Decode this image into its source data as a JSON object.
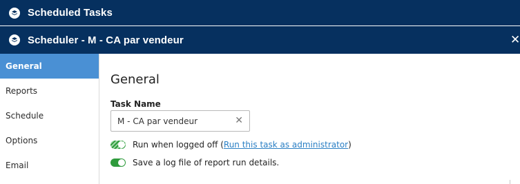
{
  "window": {
    "outer_title": "Scheduled Tasks",
    "inner_title": "Scheduler - M - CA par vendeur",
    "close_glyph": "✕"
  },
  "sidebar": {
    "items": [
      {
        "label": "General",
        "active": true
      },
      {
        "label": "Reports",
        "active": false
      },
      {
        "label": "Schedule",
        "active": false
      },
      {
        "label": "Options",
        "active": false
      },
      {
        "label": "Email",
        "active": false
      }
    ]
  },
  "main": {
    "heading": "General",
    "task_name_label": "Task Name",
    "task_name_value": "M - CA par vendeur",
    "clear_glyph": "✕",
    "run_logged_off_label": "Run when logged off",
    "paren_open": "(",
    "run_as_admin_link": "Run this task as administrator",
    "paren_close": ")",
    "save_log_label": "Save a log file of report run details."
  },
  "colors": {
    "titlebar": "#06305f",
    "active_nav": "#4a90d4",
    "toggle_green": "#2e9b3c",
    "link": "#2a7fc4"
  },
  "icons": {
    "app": "layers-icon",
    "close": "close-icon",
    "clear": "clear-icon"
  }
}
